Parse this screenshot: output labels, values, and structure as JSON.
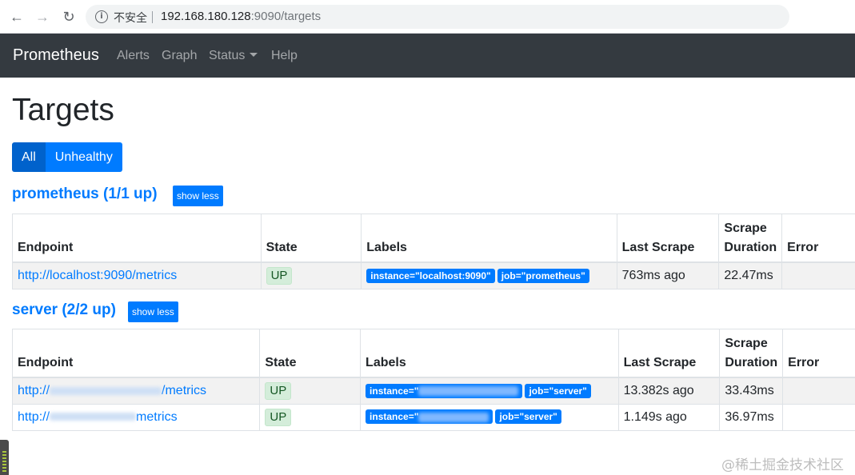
{
  "browser": {
    "security_label": "不安全",
    "url_host": "192.168.180.128",
    "url_path": ":9090/targets"
  },
  "navbar": {
    "brand": "Prometheus",
    "links": [
      "Alerts",
      "Graph",
      "Status",
      "Help"
    ]
  },
  "page": {
    "title": "Targets",
    "filters": [
      "All",
      "Unhealthy"
    ]
  },
  "columns": [
    "Endpoint",
    "State",
    "Labels",
    "Last Scrape",
    "Scrape",
    "Duration",
    "Error"
  ],
  "jobs": [
    {
      "title": "prometheus (1/1 up)",
      "toggle": "show less",
      "rows": [
        {
          "endpoint": "http://localhost:9090/metrics",
          "state": "UP",
          "labels": [
            "instance=\"localhost:9090\"",
            "job=\"prometheus\""
          ],
          "last_scrape": "763ms ago",
          "duration": "22.47ms",
          "error": ""
        }
      ]
    },
    {
      "title": "server (2/2 up)",
      "toggle": "show less",
      "rows": [
        {
          "endpoint_prefix": "http://",
          "endpoint_suffix": "/metrics",
          "state": "UP",
          "label_instance_prefix": "instance=\"",
          "label_job": "job=\"server\"",
          "last_scrape": "13.382s ago",
          "duration": "33.43ms",
          "error": ""
        },
        {
          "endpoint_prefix": "http://",
          "endpoint_suffix": "metrics",
          "state": "UP",
          "label_instance_prefix": "instance=\"",
          "label_job": "job=\"server\"",
          "last_scrape": "1.149s ago",
          "duration": "36.97ms",
          "error": ""
        }
      ]
    }
  ],
  "watermark": "@稀土掘金技术社区",
  "icons": [
    "back-arrow-icon",
    "forward-arrow-icon",
    "reload-icon",
    "info-icon",
    "caret-down-icon"
  ]
}
